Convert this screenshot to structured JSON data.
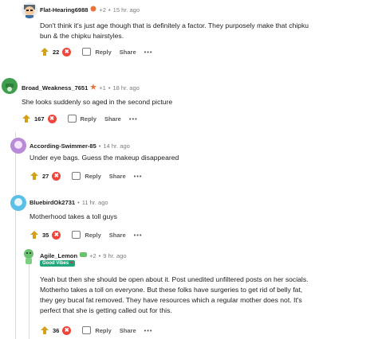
{
  "comments": [
    {
      "username": "Flat-Hearing6988",
      "flair_count": "+2",
      "time": "15 hr. ago",
      "body": [
        "Don't think it's just age though that is definitely a factor. They purposely make that chipku",
        "bun & the chipku hairstyles."
      ],
      "score": "22"
    },
    {
      "username": "Broad_Weakness_7651",
      "flair_count": "+1",
      "time": "18 hr. ago",
      "body": [
        "She looks suddenly so aged in the second picture"
      ],
      "score": "167"
    },
    {
      "username": "According-Swimmer-85",
      "time": "14 hr. ago",
      "body": [
        "Under eye bags. Guess the makeup disappeared"
      ],
      "score": "27"
    },
    {
      "username": "BluebirdOk2731",
      "time": "11 hr. ago",
      "body": [
        "Motherhood takes a toll guys"
      ],
      "score": "35"
    },
    {
      "username": "Agile_Lemon",
      "flair_count": "+2",
      "time": "9 hr. ago",
      "user_flair": "Good Vibes",
      "body": [
        "Yeah but then she should be open about it. Post unedited unfiltered posts on her socials.",
        "Motherho takes a toll on everyone. But these folks have surgeries to get rid of belly fat,",
        "they gey bucal fat removed. They have resources which a regular mother does not. It's",
        "perfect that she is getting called out for this."
      ],
      "score": "36"
    }
  ],
  "actions": {
    "reply": "Reply",
    "share": "Share",
    "more": "•••",
    "dot": "•",
    "award": "✖"
  },
  "icons": {
    "upvote": "upvote-icon",
    "reply": "reply-icon",
    "award": "award-icon"
  },
  "colors": {
    "award": "#f0453b",
    "good_vibes": "#1fa67a",
    "upvote": "#d4a017"
  }
}
